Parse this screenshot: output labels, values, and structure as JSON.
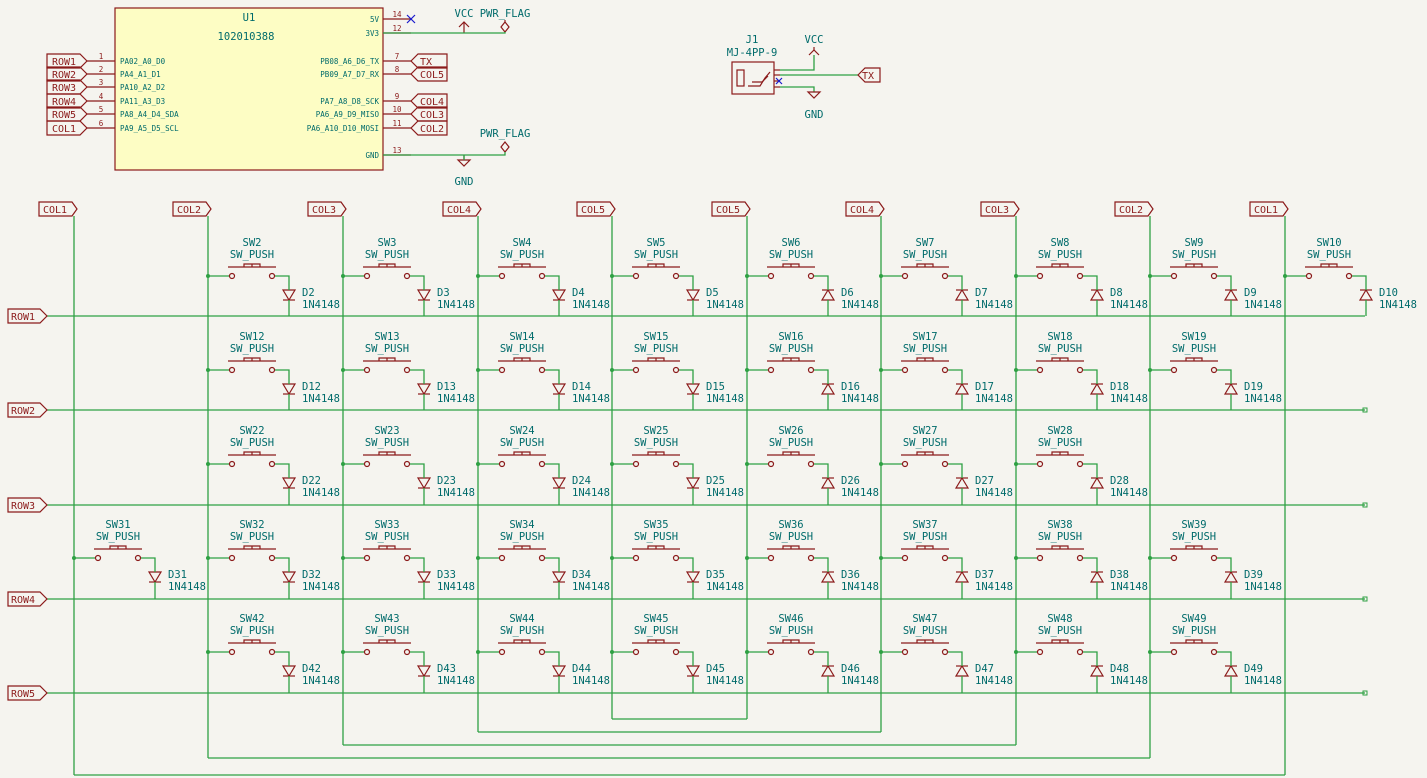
{
  "u1": {
    "ref": "U1",
    "value": "102010388",
    "left_pins": [
      {
        "num": "1",
        "name": "PA02_A0_D0",
        "net": "ROW1"
      },
      {
        "num": "2",
        "name": "PA4_A1_D1",
        "net": "ROW2"
      },
      {
        "num": "3",
        "name": "PA10_A2_D2",
        "net": "ROW3"
      },
      {
        "num": "4",
        "name": "PA11_A3_D3",
        "net": "ROW4"
      },
      {
        "num": "5",
        "name": "PA8_A4_D4_SDA",
        "net": "ROW5"
      },
      {
        "num": "6",
        "name": "PA9_A5_D5_SCL",
        "net": "COL1"
      }
    ],
    "right_pins": [
      {
        "num": "14",
        "name": "5V",
        "net": ""
      },
      {
        "num": "12",
        "name": "3V3",
        "net": ""
      },
      {
        "num": "7",
        "name": "PB08_A6_D6_TX",
        "net": "TX"
      },
      {
        "num": "8",
        "name": "PB09_A7_D7_RX",
        "net": "COL5"
      },
      {
        "num": "9",
        "name": "PA7_A8_D8_SCK",
        "net": "COL4"
      },
      {
        "num": "10",
        "name": "PA6_A9_D9_MISO",
        "net": "COL3"
      },
      {
        "num": "11",
        "name": "PA6_A10_D10_MOSI",
        "net": "COL2"
      },
      {
        "num": "13",
        "name": "GND",
        "net": ""
      }
    ]
  },
  "power": {
    "vcc": "VCC",
    "gnd": "GND",
    "pwr_flag": "PWR_FLAG"
  },
  "j1": {
    "ref": "J1",
    "value": "MJ-4PP-9",
    "net_tx": "TX"
  },
  "columns": [
    "COL1",
    "COL2",
    "COL3",
    "COL4",
    "COL5",
    "COL5",
    "COL4",
    "COL3",
    "COL2",
    "COL1"
  ],
  "rows": [
    "ROW1",
    "ROW2",
    "ROW3",
    "ROW4",
    "ROW5"
  ],
  "switch_value": "SW_PUSH",
  "diode_value": "1N4148",
  "matrix": [
    [
      2,
      3,
      4,
      5,
      6,
      7,
      8,
      9,
      10
    ],
    [
      12,
      13,
      14,
      15,
      16,
      17,
      18,
      19
    ],
    [
      22,
      23,
      24,
      25,
      26,
      27,
      28
    ],
    [
      31,
      32,
      33,
      34,
      35,
      36,
      37,
      38,
      39
    ],
    [
      42,
      43,
      44,
      45,
      46,
      47,
      48,
      49
    ]
  ]
}
